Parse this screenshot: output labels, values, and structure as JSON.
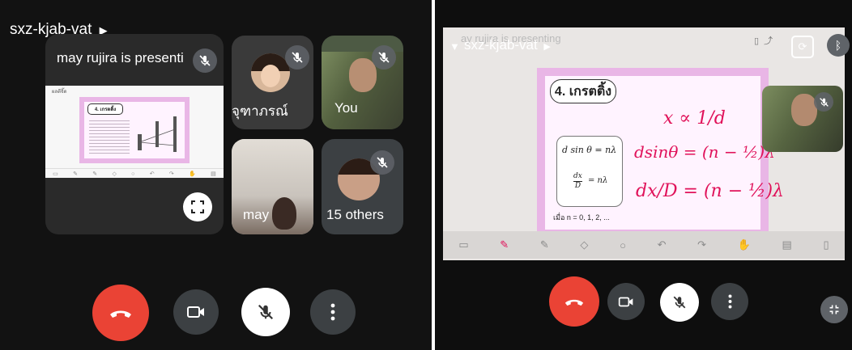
{
  "left": {
    "meeting_code": "sxz-kjab-vat",
    "presenting_text": "may rujira is presenti",
    "participants": [
      {
        "name": "จุฑาภรณ์"
      },
      {
        "name": "You"
      },
      {
        "name": "may"
      },
      {
        "name": "15 others"
      }
    ],
    "slide": {
      "heading": "4. เกรตติ้ง",
      "url": "ผลดีจิ๊ด"
    }
  },
  "right": {
    "meeting_code": "sxz-kjab-vat",
    "faded_title": "ay rujira is presenting",
    "slide": {
      "heading": "4. เกรตติ้ง",
      "formula_1": "d sin θ = nλ",
      "formula_2_num": "dx",
      "formula_2_den": "D",
      "formula_2_rhs": "= nλ",
      "footnote": "เมื่อ n = 0, 1, 2, ...",
      "ink_1": "x ∝ 1/d",
      "ink_2": "dsinθ = (n − ½)λ",
      "ink_3": "dx/D = (n − ½)λ"
    }
  },
  "colors": {
    "end_call": "#ea4335",
    "control_bg": "#3c4043",
    "mic_bg": "#ffffff",
    "ink": "#e0125a",
    "slide_pink": "#e9b6e6"
  }
}
